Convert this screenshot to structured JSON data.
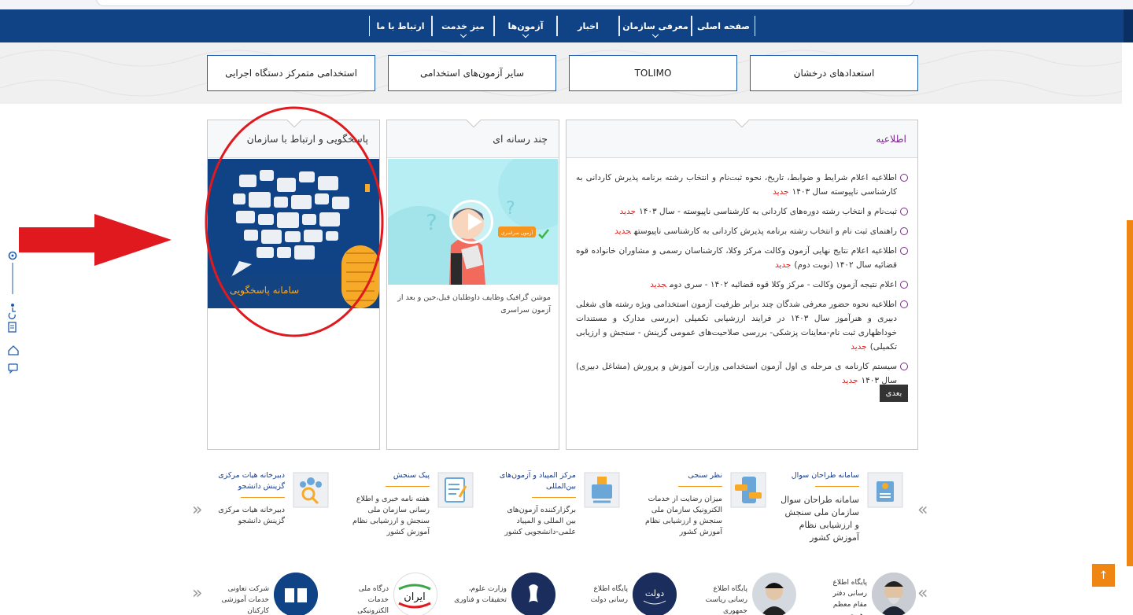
{
  "nav": {
    "items": [
      {
        "label": "صفحه اصلی",
        "dropdown": false
      },
      {
        "label": "معرفی سازمان",
        "dropdown": true
      },
      {
        "label": "اخبار",
        "dropdown": false
      },
      {
        "label": "آزمون‌ها",
        "dropdown": true
      },
      {
        "label": "میز خدمت",
        "dropdown": true
      },
      {
        "label": "ارتباط با ما",
        "dropdown": false
      }
    ]
  },
  "quick_buttons": [
    "استعدادهای درخشان",
    "TOLIMO",
    "سایر آزمون‌های استخدامی",
    "استخدامی متمرکز دستگاه اجرایی"
  ],
  "announcements": {
    "title": "اطلاعیه",
    "new_label": "جدید",
    "items": [
      "اطلاعیه اعلام شرایط و ضوابط، تاریخ، نحوه ثبت‌نام و انتخاب رشته برنامه پذیرش کاردانی به کارشناسی ناپیوسته سال ۱۴۰۳",
      "ثبت‌نام و انتخاب رشته دوره‌های کاردانی به کارشناسی ناپیوسته - سال ۱۴۰۳",
      "راهنمای ثبت نام و انتخاب رشته برنامه پذیرش کاردانی به کارشناسی ناپیوسته",
      "اطلاعیه اعلام نتایج نهایی آزمون وکالت مرکز وکلا، کارشناسان رسمی و مشاوران خانواده قوه قضائیه سال ۱۴۰۲ (نوبت دوم)",
      "اعلام نتیجه آزمون وکالت - مرکز وکلا قوه قضائیه ۱۴۰۲ - سری دوم",
      "اطلاعیه نحوه حضور معرفی شدگان چند برابر ظرفیت آزمون استخدامی ویژه رشته های شغلی دبیری و هنرآموز سال ۱۴۰۳ در فرایند ارزشیابی تکمیلی (بررسی مدارک و مستندات خوداظهاری ثبت نام-معاینات پزشکی- بررسی صلاحیت‌های عمومی گزینش - سنجش و ارزیابی تکمیلی)",
      "سیستم کارنامه ی مرحله ی اول آزمون استخدامی وزارت آموزش و پرورش (مشاغل دبیری) سال ۱۴۰۳"
    ],
    "next_label": "بعدی"
  },
  "media": {
    "title": "چند رسانه ای",
    "badge": "آزمون سراسری",
    "caption": "موشن گرافیک وظایف داوطلبان قبل،حین و بعد از آزمون سراسری"
  },
  "support": {
    "title": "پاسخگویی و ارتباط با سازمان",
    "banner_text": "سامانه پاسخگویی"
  },
  "services": [
    {
      "title": "سامانه طراحان سوال",
      "desc": "سامانه طراحان سوال سازمان ملی سنجش و ارزشیابی نظام آموزش کشور",
      "icon": "question-designers-icon"
    },
    {
      "title": "نظر سنجی",
      "desc": "میزان رضایت از خدمات الکترونیک سازمان ملی سنجش و ارزشیابی نظام آموزش کشور",
      "icon": "survey-icon"
    },
    {
      "title": "مرکز المپیاد و آزمون‌های بین‌المللی",
      "desc": "برگزارکننده آزمون‌های بین المللی و المپیاد علمی-دانشجویی کشور",
      "icon": "olympiad-icon"
    },
    {
      "title": "پیک سنجش",
      "desc": "هفته نامه خبری و اطلاع رسانی سازمان ملی سنجش و ارزشیابی نظام آموزش کشور",
      "icon": "newsletter-icon"
    },
    {
      "title": "دبیرخانه هیات مرکزی گزینش دانشجو",
      "desc": "دبیرخانه هیات مرکزی گزینش دانشجو",
      "icon": "selection-board-icon"
    }
  ],
  "links": [
    {
      "label": "پایگاه اطلاع رسانی دفتر مقام معظم رهبری"
    },
    {
      "label": "پایگاه اطلاع رسانی ریاست جمهوری"
    },
    {
      "label": "پایگاه اطلاع رسانی دولت",
      "logo_text": "دولت"
    },
    {
      "label": "وزارت علوم، تحقیقات و فناوری"
    },
    {
      "label": "درگاه ملی خدمات الکترونیکی",
      "logo_text": "ایران"
    },
    {
      "label": "شرکت تعاونی خدمات آموزشی کارکنان"
    }
  ],
  "colors": {
    "nav_bg": "#0f4385",
    "accent": "#ef8513",
    "new_badge": "#e11d1d",
    "annotation": "#e0191f",
    "title_purple": "#7b2a8c"
  }
}
